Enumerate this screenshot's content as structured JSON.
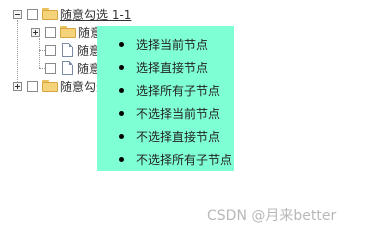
{
  "tree": {
    "nodes": [
      {
        "label": "随意勾选 1-1",
        "type": "folder",
        "expander": "minus"
      },
      {
        "label": "随意勾选",
        "type": "folder",
        "expander": "plus"
      },
      {
        "label": "随意勾选",
        "type": "file"
      },
      {
        "label": "随意勾选",
        "type": "file"
      },
      {
        "label": "随意勾选",
        "type": "folder",
        "expander": "plus"
      }
    ]
  },
  "context_menu": {
    "items": [
      "选择当前节点",
      "选择直接节点",
      "选择所有子节点",
      "不选择当前节点",
      "不选择直接节点",
      "不选择所有子节点"
    ]
  },
  "watermark": "CSDN @月来better",
  "colors": {
    "menu_bg": "#7fffd4",
    "folder": "#f5d37a"
  }
}
